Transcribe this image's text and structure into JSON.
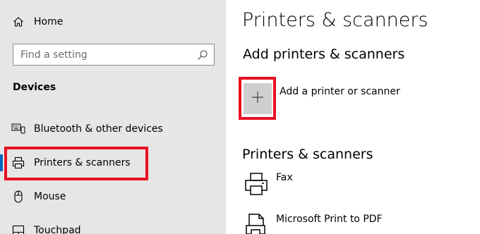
{
  "sidebar": {
    "home": {
      "label": "Home",
      "icon": "home-icon"
    },
    "search": {
      "placeholder": "Find a setting",
      "icon": "search-icon"
    },
    "section": "Devices",
    "items": [
      {
        "label": "Bluetooth & other devices",
        "icon": "bluetooth-keyboard-icon"
      },
      {
        "label": "Printers & scanners",
        "icon": "printer-icon",
        "selected": true
      },
      {
        "label": "Mouse",
        "icon": "mouse-icon"
      },
      {
        "label": "Touchpad",
        "icon": "touchpad-icon"
      }
    ]
  },
  "main": {
    "title": "Printers & scanners",
    "add_section_title": "Add printers & scanners",
    "add_button_label": "Add a printer or scanner",
    "list_title": "Printers & scanners",
    "devices": [
      {
        "name": "Fax",
        "icon": "fax-printer-icon"
      },
      {
        "name": "Microsoft Print to PDF",
        "icon": "pdf-printer-icon"
      }
    ]
  },
  "colors": {
    "sidebar_bg": "#e6e6e6",
    "accent": "#0067c0",
    "highlight": "#e81123",
    "add_button_bg": "#cfcfcf"
  }
}
